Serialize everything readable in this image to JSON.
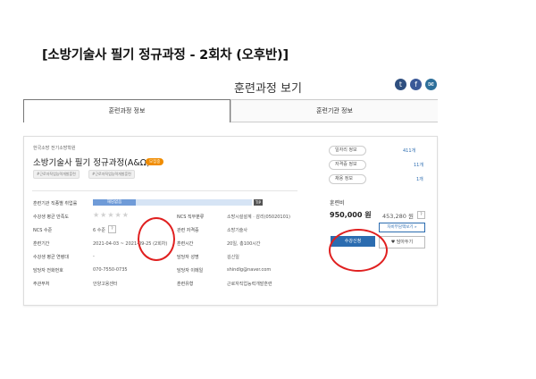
{
  "banner_title": "[소방기술사 필기 정규과정 - 2회차 (오후반)]",
  "page_title": "훈련과정 보기",
  "share_icons": [
    "twitter-icon",
    "facebook-icon",
    "message-icon"
  ],
  "tabs": [
    "훈련과정 정보",
    "훈련기관 정보"
  ],
  "course": {
    "institution": "한국소방 전기소방학원",
    "title": "소방기술사 필기 정규과정(A&Ω)",
    "status_badge": "모집중",
    "tags": [
      "#근로자직업능력개발훈련",
      "#근로자직업능력개발훈련"
    ]
  },
  "details_left": [
    {
      "label": "훈련기관 직종별 취업률",
      "value": ""
    },
    {
      "label": "수강생 평균 만족도",
      "value": ""
    },
    {
      "label": "NCS 수준",
      "value": "6 수준"
    },
    {
      "label": "훈련기간",
      "value": "2021-04-03 ~ 2021-09-25 (2회차)"
    },
    {
      "label": "수강생 평균 연령대",
      "value": "-"
    },
    {
      "label": "담당자 전화번호",
      "value": "070-7550-0735"
    },
    {
      "label": "주관부처",
      "value": "안양고용센터"
    }
  ],
  "details_right": [
    {
      "label": "NCS 직무분류",
      "value": "소방시설설계 · 감리(05020101)"
    },
    {
      "label": "관련 자격증",
      "value": "소방기술사"
    },
    {
      "label": "훈련시간",
      "value": "20일, 총100시간"
    },
    {
      "label": "담당자 성명",
      "value": "김신일"
    },
    {
      "label": "담당자 이메일",
      "value": "shindlg@naver.com"
    },
    {
      "label": "훈련유형",
      "value": "근로자직업능력개발훈련"
    }
  ],
  "employment_bar_label": "해당없음",
  "employment_tip": "TIP",
  "ncs_help": "?",
  "side_info": [
    {
      "label": "일자리 정보",
      "value": "411개"
    },
    {
      "label": "자격증 정보",
      "value": "11개"
    },
    {
      "label": "채용 정보",
      "value": "1개"
    }
  ],
  "fee": {
    "heading": "훈련비",
    "price": "950,000 원",
    "support_price": "453,280 원",
    "help": "?",
    "self_pay_link": "자비부담액보기 »",
    "apply_button": "수강신청",
    "wish_button": "담아두기"
  },
  "stars": "★★★★★",
  "colors": {
    "accent": "#2b6cb0",
    "badge": "#f08c00",
    "circle": "#e02020"
  }
}
